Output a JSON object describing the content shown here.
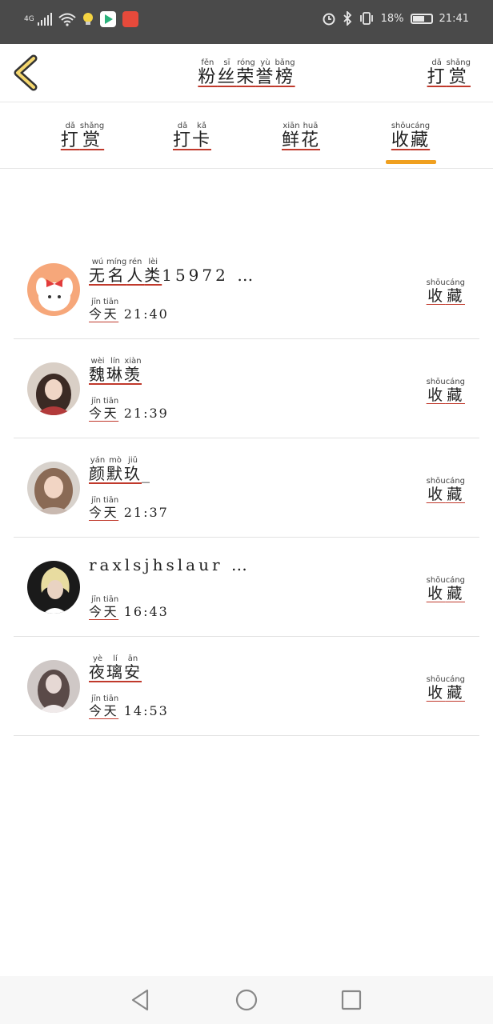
{
  "status_bar": {
    "network": "4G",
    "right_text_left": "18%",
    "right_text_time": "21:41"
  },
  "header": {
    "title_chars": [
      {
        "char": "粉",
        "py": "fěn"
      },
      {
        "char": "丝",
        "py": "sī"
      },
      {
        "char": "荣",
        "py": "róng"
      },
      {
        "char": "誉",
        "py": "yù"
      },
      {
        "char": "榜",
        "py": "bǎng"
      }
    ],
    "reward_chars": [
      {
        "char": "打",
        "py": "dǎ"
      },
      {
        "char": "赏",
        "py": "shǎng"
      }
    ]
  },
  "tabs": [
    {
      "chars": [
        {
          "char": "打",
          "py": "dǎ"
        },
        {
          "char": "赏",
          "py": "shǎng"
        }
      ]
    },
    {
      "chars": [
        {
          "char": "打",
          "py": "dǎ"
        },
        {
          "char": "卡",
          "py": "kǎ"
        }
      ]
    },
    {
      "chars": [
        {
          "char": "鲜",
          "py": "xiān"
        },
        {
          "char": "花",
          "py": "huā"
        }
      ]
    },
    {
      "chars": [
        {
          "char": "收",
          "py": "shōu"
        },
        {
          "char": "藏",
          "py": "cáng"
        }
      ]
    }
  ],
  "active_tab": 3,
  "accent_color": "#f0a020",
  "list": [
    {
      "name_chars": [
        {
          "char": "无",
          "py": "wú"
        },
        {
          "char": "名",
          "py": "míng"
        },
        {
          "char": "人",
          "py": "rén"
        },
        {
          "char": "类",
          "py": "lèi"
        }
      ],
      "name_suffix": "15972 …",
      "day": [
        {
          "char": "今",
          "py": "jīn"
        },
        {
          "char": "天",
          "py": "tiān"
        }
      ],
      "time": "21:40",
      "action": [
        {
          "char": "收",
          "py": "shōu"
        },
        {
          "char": "藏",
          "py": "cáng"
        }
      ]
    },
    {
      "name_chars": [
        {
          "char": "魏",
          "py": "wèi"
        },
        {
          "char": "琳",
          "py": "lín"
        },
        {
          "char": "羡",
          "py": "xiàn"
        }
      ],
      "name_suffix": "",
      "day": [
        {
          "char": "今",
          "py": "jīn"
        },
        {
          "char": "天",
          "py": "tiān"
        }
      ],
      "time": "21:39",
      "action": [
        {
          "char": "收",
          "py": "shōu"
        },
        {
          "char": "藏",
          "py": "cáng"
        }
      ]
    },
    {
      "name_chars": [
        {
          "char": "颜",
          "py": "yán"
        },
        {
          "char": "默",
          "py": "mò"
        },
        {
          "char": "玖",
          "py": "jiǔ"
        }
      ],
      "name_suffix": "_",
      "day": [
        {
          "char": "今",
          "py": "jīn"
        },
        {
          "char": "天",
          "py": "tiān"
        }
      ],
      "time": "21:37",
      "action": [
        {
          "char": "收",
          "py": "shōu"
        },
        {
          "char": "藏",
          "py": "cáng"
        }
      ]
    },
    {
      "name_chars": [],
      "name_suffix": "raxlsjhslaur …",
      "day": [
        {
          "char": "今",
          "py": "jīn"
        },
        {
          "char": "天",
          "py": "tiān"
        }
      ],
      "time": "16:43",
      "action": [
        {
          "char": "收",
          "py": "shōu"
        },
        {
          "char": "藏",
          "py": "cáng"
        }
      ]
    },
    {
      "name_chars": [
        {
          "char": "夜",
          "py": "yè"
        },
        {
          "char": "璃",
          "py": "lí"
        },
        {
          "char": "安",
          "py": "ān"
        }
      ],
      "name_suffix": "",
      "day": [
        {
          "char": "今",
          "py": "jīn"
        },
        {
          "char": "天",
          "py": "tiān"
        }
      ],
      "time": "14:53",
      "action": [
        {
          "char": "收",
          "py": "shōu"
        },
        {
          "char": "藏",
          "py": "cáng"
        }
      ]
    }
  ],
  "icons": {
    "back": "chevron-left-icon",
    "nav_back": "triangle-back-icon",
    "nav_home": "circle-home-icon",
    "nav_recent": "square-recent-icon"
  }
}
